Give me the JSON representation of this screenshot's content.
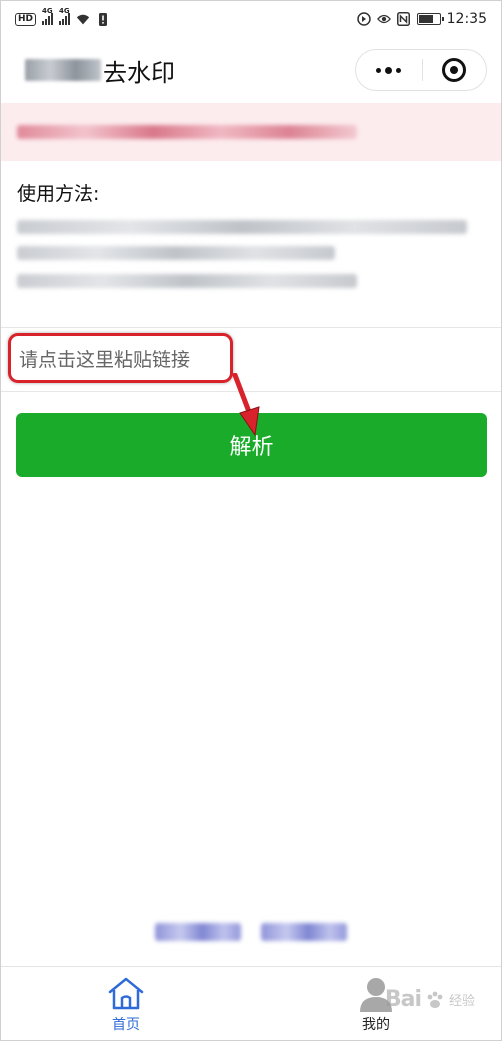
{
  "status_bar": {
    "time": "12:35",
    "hd_badge": "HD",
    "network_label": "4G"
  },
  "navbar": {
    "title": "去水印"
  },
  "usage": {
    "title": "使用方法:"
  },
  "input": {
    "placeholder": "请点击这里粘贴链接",
    "value": ""
  },
  "parse_button": {
    "label": "解析"
  },
  "tabbar": {
    "home_label": "首页",
    "mine_label": "我的"
  },
  "watermark": {
    "text": "Bai",
    "sub": "经验"
  },
  "colors": {
    "primary_button": "#1aab2b",
    "active_tab": "#2f6bd8",
    "notice_bg": "#fcecee",
    "highlight_frame": "#d9232c"
  }
}
